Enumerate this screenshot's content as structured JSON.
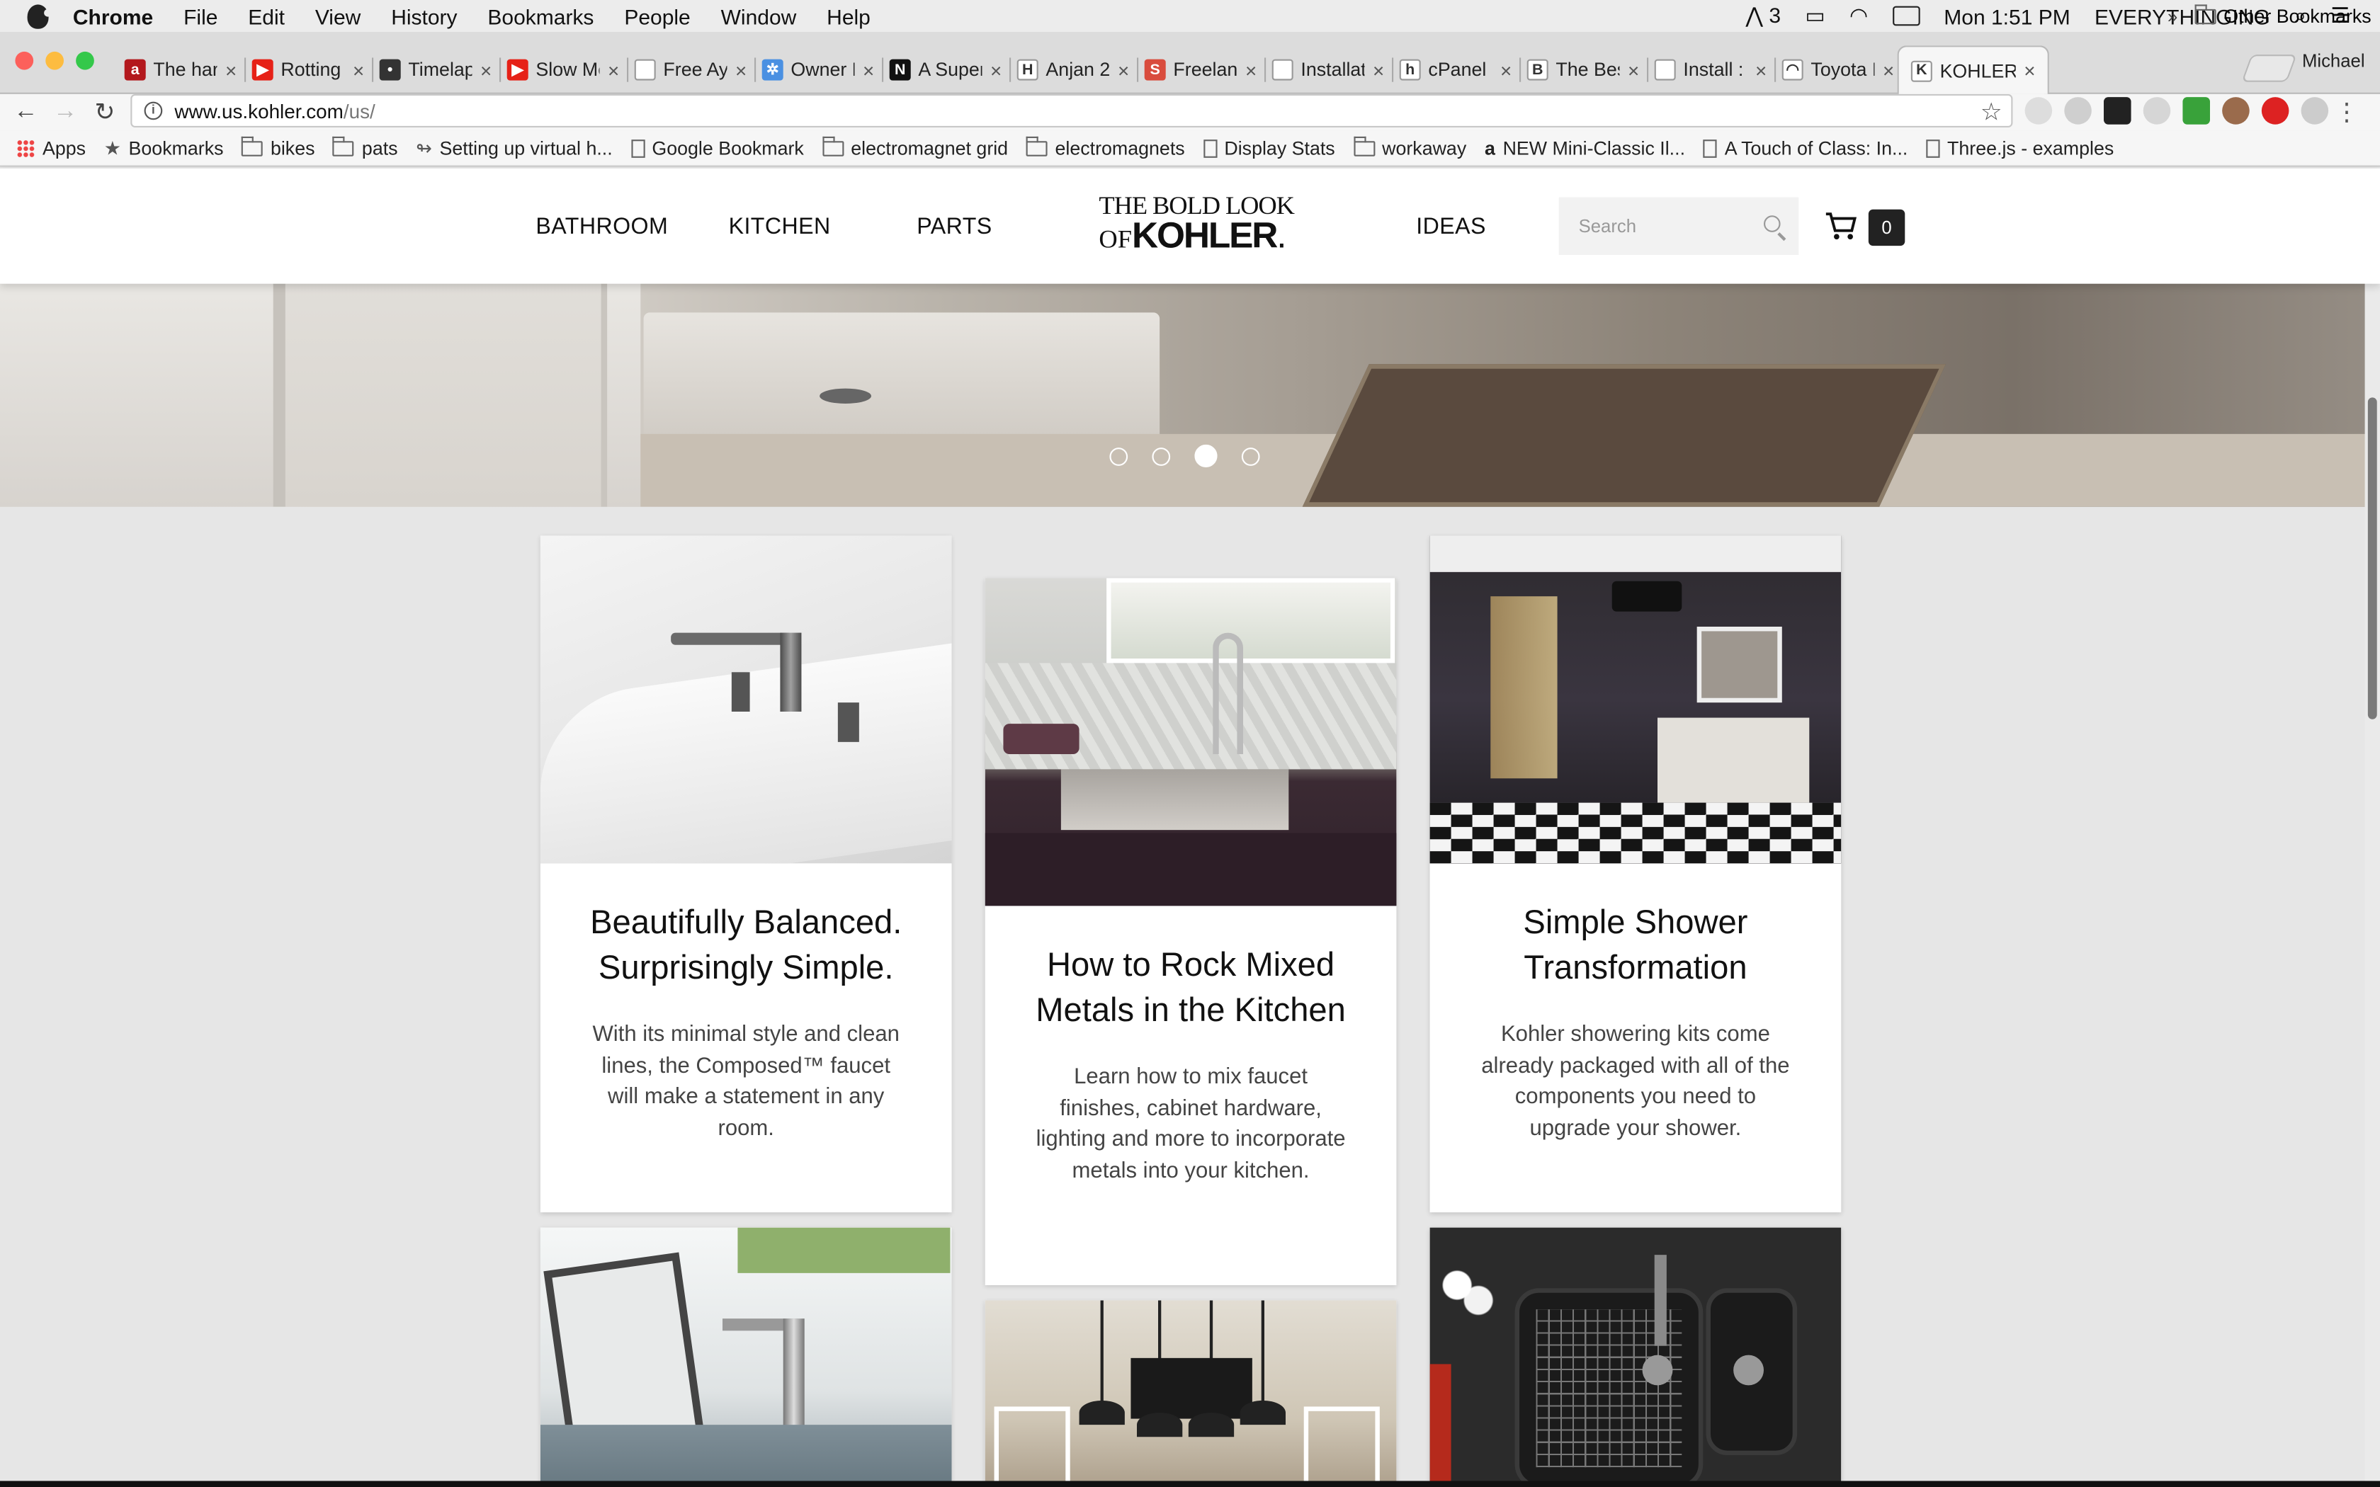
{
  "menubar": {
    "app": "Chrome",
    "items": [
      "File",
      "Edit",
      "View",
      "History",
      "Bookmarks",
      "People",
      "Window",
      "Help"
    ],
    "status_adobe": "3",
    "clock": "Mon 1:51 PM",
    "user": "EVERYTHINGING"
  },
  "tabs": [
    {
      "title": "The hard",
      "color": "#b3181d",
      "glyph": "a"
    },
    {
      "title": "Rotting",
      "color": "#e62117",
      "glyph": "▶"
    },
    {
      "title": "Timelap",
      "color": "#333333",
      "glyph": "•"
    },
    {
      "title": "Slow Mo",
      "color": "#e62117",
      "glyph": "▶"
    },
    {
      "title": "Free Aya",
      "color": "#ffffff",
      "glyph": ""
    },
    {
      "title": "Owner F",
      "color": "#4a90e2",
      "glyph": "✲"
    },
    {
      "title": "A Super",
      "color": "#111111",
      "glyph": "N"
    },
    {
      "title": "Anjan 2",
      "color": "#ffffff",
      "glyph": "H"
    },
    {
      "title": "Freelanc",
      "color": "#d94c3d",
      "glyph": "S"
    },
    {
      "title": "Installat",
      "color": "#ffffff",
      "glyph": ""
    },
    {
      "title": "cPanel X",
      "color": "#ffffff",
      "glyph": "h"
    },
    {
      "title": "The Bes",
      "color": "#ffffff",
      "glyph": "B"
    },
    {
      "title": "Install : I",
      "color": "#ffffff",
      "glyph": ""
    },
    {
      "title": "Toyota I",
      "color": "#ffffff",
      "glyph": "◠"
    },
    {
      "title": "KOHLER",
      "color": "#ffffff",
      "glyph": "K",
      "active": true
    }
  ],
  "profile_name": "Michael",
  "url": {
    "host": "www.us.kohler.com",
    "path": "/us/"
  },
  "bookmarks": [
    {
      "label": "Apps",
      "icon": "apps-icon"
    },
    {
      "label": "Bookmarks",
      "icon": "star-icon"
    },
    {
      "label": "bikes",
      "icon": "folder-icon"
    },
    {
      "label": "pats",
      "icon": "folder-icon"
    },
    {
      "label": "Setting up virtual h...",
      "icon": "link-icon"
    },
    {
      "label": "Google Bookmark",
      "icon": "page-icon"
    },
    {
      "label": "electromagnet grid",
      "icon": "folder-icon"
    },
    {
      "label": "electromagnets",
      "icon": "folder-icon"
    },
    {
      "label": "Display Stats",
      "icon": "page-icon"
    },
    {
      "label": "workaway",
      "icon": "folder-icon"
    },
    {
      "label": "NEW Mini-Classic Il...",
      "icon": "amazon-icon"
    },
    {
      "label": "A Touch of Class: In...",
      "icon": "page-icon"
    },
    {
      "label": "Three.js - examples",
      "icon": "page-icon"
    }
  ],
  "bookmarks_overflow": "»",
  "other_bookmarks": "Other Bookmarks",
  "site": {
    "nav": {
      "bathroom": "BATHROOM",
      "kitchen": "KITCHEN",
      "parts": "PARTS",
      "ideas": "IDEAS"
    },
    "logo": {
      "line1": "THE BOLD LOOK",
      "of": "OF",
      "brand": "KOHLER",
      "mark": "."
    },
    "search_placeholder": "Search",
    "cart_count": "0"
  },
  "carousel": {
    "slides": 4,
    "active_index": 2
  },
  "cards": [
    {
      "title": "Beautifully Balanced. Surprisingly Simple.",
      "text": "With its minimal style and clean lines, the Composed™ faucet will make a statement in any room."
    },
    {
      "title": "How to Rock Mixed Metals in the Kitchen",
      "text": "Learn how to mix faucet finishes, cabinet hardware, lighting and more to incorporate metals into your kitchen."
    },
    {
      "title": "Simple Shower Transformation",
      "text": "Kohler showering kits come already packaged with all of the components you need to upgrade your shower."
    }
  ]
}
